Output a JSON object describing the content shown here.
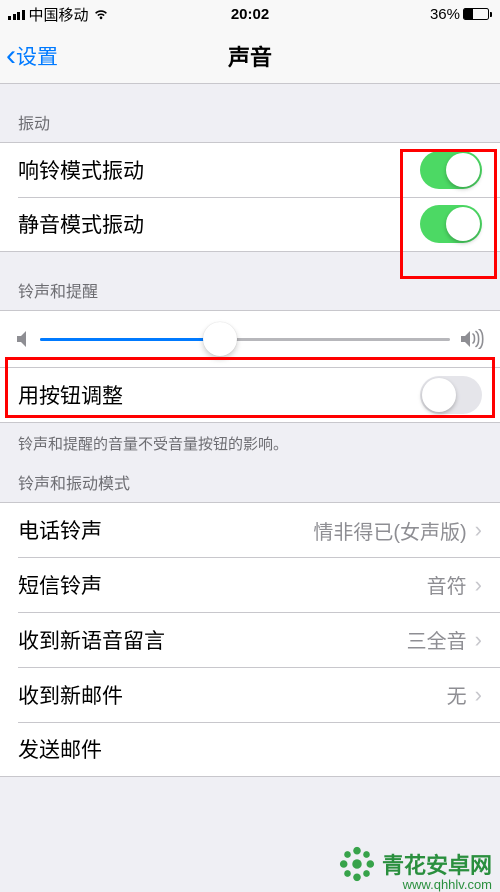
{
  "status": {
    "carrier": "中国移动",
    "time": "20:02",
    "battery_pct": "36%"
  },
  "nav": {
    "back_label": "设置",
    "title": "声音"
  },
  "sections": {
    "vibration_header": "振动",
    "ring_vibrate_label": "响铃模式振动",
    "silent_vibrate_label": "静音模式振动",
    "ringer_header": "铃声和提醒",
    "change_with_buttons_label": "用按钮调整",
    "ringer_footer": "铃声和提醒的音量不受音量按钮的影响。",
    "patterns_header": "铃声和振动模式",
    "items": {
      "ringtone_label": "电话铃声",
      "ringtone_value": "情非得已(女声版)",
      "text_label": "短信铃声",
      "text_value": "音符",
      "voicemail_label": "收到新语音留言",
      "voicemail_value": "三全音",
      "mail_label": "收到新邮件",
      "mail_value": "无",
      "sent_mail_label": "发送邮件"
    }
  },
  "toggles": {
    "ring_vibrate": true,
    "silent_vibrate": true,
    "change_with_buttons": false
  },
  "slider": {
    "value_pct": 44
  },
  "watermark": {
    "text": "青花安卓网",
    "url": "www.qhhlv.com"
  }
}
